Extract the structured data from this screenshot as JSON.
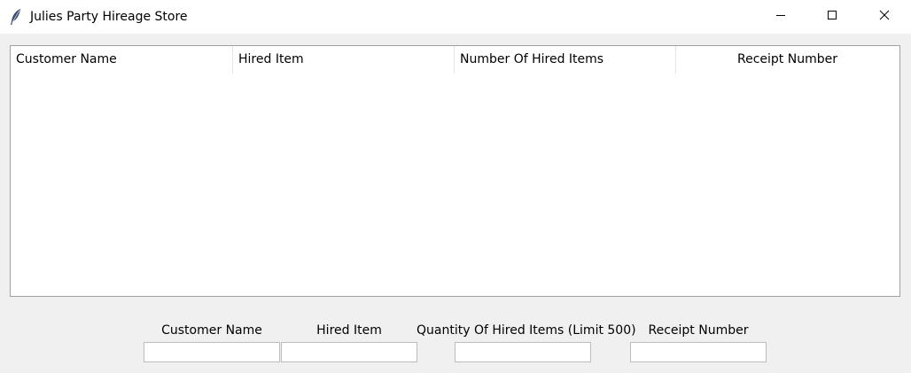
{
  "window": {
    "title": "Julies Party Hireage Store",
    "app_icon": "feather-icon",
    "controls": [
      "minimize-icon",
      "maximize-icon",
      "close-icon"
    ]
  },
  "table": {
    "columns": [
      "Customer Name",
      "Hired Item",
      "Number Of Hired Items",
      "Receipt Number"
    ],
    "rows": []
  },
  "form": {
    "customer_name": {
      "label": "Customer Name",
      "value": ""
    },
    "hired_item": {
      "label": "Hired Item",
      "value": ""
    },
    "quantity": {
      "label": "Quantity Of Hired Items (Limit 500)",
      "value": ""
    },
    "receipt_number": {
      "label": "Receipt Number",
      "value": ""
    }
  }
}
